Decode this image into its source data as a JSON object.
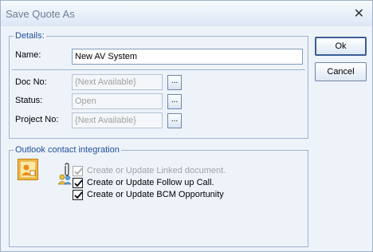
{
  "window": {
    "title": "Save Quote As",
    "close_glyph": "✕"
  },
  "details": {
    "legend": "Details:",
    "name_label": "Name:",
    "name_value": "New AV System",
    "doc_no_label": "Doc No:",
    "doc_no_value": "{Next Available}",
    "status_label": "Status:",
    "status_value": "Open",
    "project_no_label": "Project No:",
    "project_no_value": "{Next Available}",
    "browse_label": "..."
  },
  "buttons": {
    "ok": "Ok",
    "cancel": "Cancel"
  },
  "outlook": {
    "legend": "Outlook contact integration",
    "options": [
      {
        "label": "Create or Update Linked document.",
        "checked": true,
        "enabled": false
      },
      {
        "label": "Create or Update Follow up Call.",
        "checked": true,
        "enabled": true
      },
      {
        "label": "Create or Update BCM Opportunity",
        "checked": true,
        "enabled": true
      }
    ]
  },
  "icons": [
    "outlook-contact-icon",
    "paperclip-icon",
    "contact-group-icon",
    "close-icon",
    "checkmark-icon"
  ],
  "colors": {
    "accent": "#1f4f9b",
    "border": "#9fb2cc",
    "background": "#eef3fa"
  }
}
